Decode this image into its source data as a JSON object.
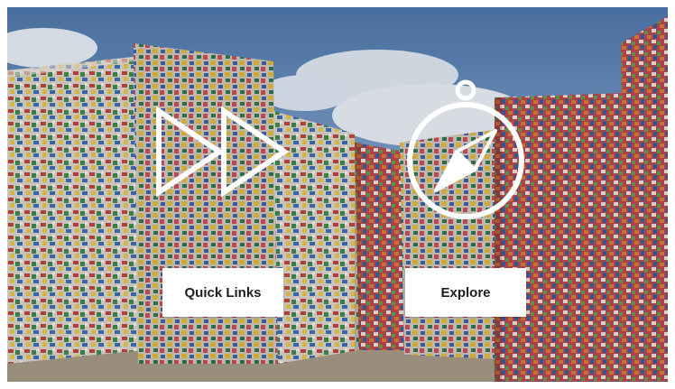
{
  "buttons": {
    "quick_links": "Quick Links",
    "explore": "Explore"
  },
  "icons": {
    "forward": "fast-forward-icon",
    "compass": "compass-icon"
  },
  "colors": {
    "button_bg": "#ffffff",
    "button_text": "#1d1d1d",
    "icon_stroke": "#ffffff",
    "sky": "#5f86b8"
  }
}
